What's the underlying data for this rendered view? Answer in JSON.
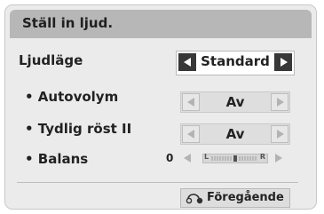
{
  "header": {
    "title": "Ställ in ljud."
  },
  "mode": {
    "label": "Ljudläge",
    "value": "Standard"
  },
  "settings": [
    {
      "label": "• Autovolym",
      "value": "Av"
    },
    {
      "label": "• Tydlig röst II",
      "value": "Av"
    }
  ],
  "balance": {
    "label": "• Balans",
    "value": "0",
    "left_marker": "L",
    "right_marker": "R",
    "level": 0.5
  },
  "footer": {
    "prev_label": "Föregående"
  },
  "icons": {
    "prev": "return-icon",
    "left": "triangle-left-icon",
    "right": "triangle-right-icon"
  },
  "colors": {
    "header_bg": "#b7b7b7",
    "panel_bg": "#ebebeb",
    "selected_arrow": "#383838"
  }
}
